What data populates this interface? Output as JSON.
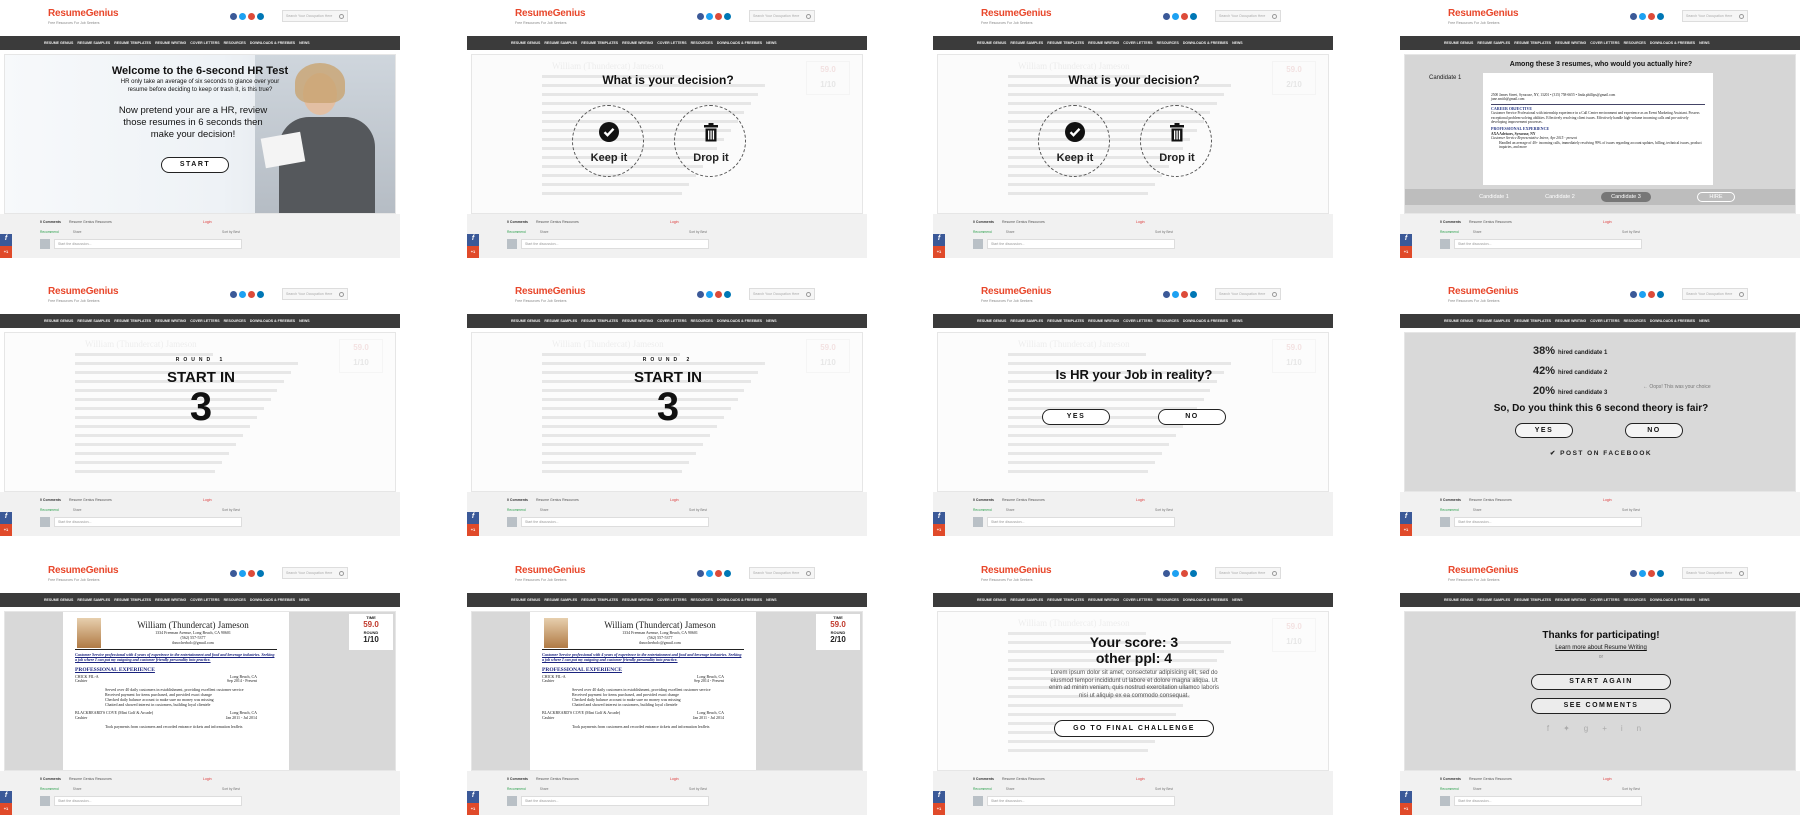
{
  "site": {
    "logo_resume": "Resume",
    "logo_genius": "Genius",
    "tagline": "Free Resources For Job Seekers",
    "search_placeholder": "Search Your Occupation Here",
    "nav": [
      "RESUME GENIUS",
      "RESUME SAMPLES",
      "RESUME TEMPLATES",
      "RESUME WRITING",
      "COVER LETTERS",
      "RESOURCES",
      "DOWNLOADS & FREEBIES",
      "NEWS"
    ],
    "social_colors": [
      "#3b5998",
      "#1da1f2",
      "#dd4b39",
      "#0077b5"
    ]
  },
  "comments": {
    "count": "0 Comments",
    "community": "Resume Genius Resources",
    "login": "Login",
    "recommend": "Recommend",
    "share": "Share",
    "sort": "Sort by Best",
    "placeholder": "Start the discussion..."
  },
  "welcome": {
    "title": "Welcome to the 6-second HR Test",
    "text": "HR only take an average of six seconds to glance over your resume before deciding to keep or trash it, is this true?",
    "prompt": "Now pretend your are a HR, review those resumes in 6 seconds then make your decision!",
    "start": "START"
  },
  "decision": {
    "title": "What is your decision?",
    "keep": "Keep it",
    "drop": "Drop it",
    "ghost_name": "William (Thundercat) Jameson",
    "ghost_time": "59.0",
    "ghost_rounds": [
      "1/10",
      "2/10"
    ]
  },
  "hire": {
    "title": "Among these 3 resumes, who would you actually hire?",
    "candidate_label": "Candidate 1",
    "resume_lines": [
      "2500 James Street, Syracuse, NY, 13201 • (315) 758-6655 • linda.phillips@gmail.com",
      "jane.smith@gmail.com"
    ],
    "objective_head": "CAREER OBJECTIVE",
    "objective": "Customer Service Professional with internship experience in a Call Center environment and experience as an Event Marketing Assistant. Possess exceptional problem-solving abilities. Effectively resolving client issues. Effectively handle high-volume incoming calls and pro-actively developing improvement processes.",
    "exp_head": "PROFESSIONAL EXPERIENCE",
    "exp_company": "AXA Advisors, Syracuse, NY",
    "exp_role": "Customer Service Representative Intern, Apr 2015 - present",
    "exp_bullet": "Handled an average of 40+ incoming calls, immediately resolving 99% of issues regarding account updates, billing, technical issues, product inquiries, and more",
    "tabs": [
      "Candidate 1",
      "Candidate 2",
      "Candidate 3"
    ],
    "hire_btn": "HIRE"
  },
  "countdown": [
    {
      "round": "ROUND 1",
      "start_in": "START IN",
      "number": "3"
    },
    {
      "round": "ROUND 2",
      "start_in": "START IN",
      "number": "3"
    }
  ],
  "hr_job": {
    "question": "Is HR your Job in reality?",
    "yes": "YES",
    "no": "NO"
  },
  "results": {
    "rows": [
      {
        "pct": "38%",
        "label": "hired candidate 1"
      },
      {
        "pct": "42%",
        "label": "hired candidate 2"
      },
      {
        "pct": "20%",
        "label": "hired candidate 3"
      }
    ],
    "oops": "← Oops! This was your choice",
    "question": "So, Do you think this 6 second theory is fair?",
    "yes": "YES",
    "no": "NO",
    "post": "POST ON FACEBOOK"
  },
  "resume": {
    "name": "William (Thundercat) Jameson",
    "address": "1334 Freeman Avenue, Long Beach, CA 90601",
    "phone": "(562) 557-5377",
    "email": "thnocherbolc@gmail.com",
    "summary": "Customer Service professional with 4 years of experience in the entertainment and food and beverage industries. Seeking a job where I can put my outgoing and customer friendly personality into practice.",
    "exp_head": "PROFESSIONAL EXPERIENCE",
    "job1_company": "CHICK FIL-A",
    "job1_loc": "Long Beach, CA",
    "job1_role": "Cashier",
    "job1_dates": "Sep 2014 - Present",
    "job1_bullets": [
      "Served over 40 daily customers in establishment, providing excellent customer service",
      "Received payment for items purchased, and provided exact change",
      "Checked daily balance account to make sure no money was missing",
      "Chatted and showed interest in customers, building loyal clientele"
    ],
    "job2_company": "BLACKBEARD'S COVE (Mini Golf & Arcade)",
    "job2_loc": "Long Beach, CA",
    "job2_role": "Cashier",
    "job2_dates": "Jan 2011 - Jul 2014",
    "job2_bullets": [
      "Took payments from customers and recorded entrance tickets and information leaflets"
    ],
    "time_label": "TIME",
    "time": "59.0",
    "round_label": "ROUND",
    "rounds": [
      "1/10",
      "2/10"
    ]
  },
  "score": {
    "line1": "Your score: 3",
    "line2": "other ppl: 4",
    "lorem": "Lorem ipsum dolor sit amet, consectetur adipisicing elit, sed do eiusmod tempor incididunt ut labore et dolore magna aliqua. Ut enim ad minim veniam, quis nostrud exercitation ullamco laboris nisi ut aliquip ex ea commodo consequat.",
    "final": "GO TO FINAL CHALLENGE"
  },
  "thanks": {
    "title": "Thanks for participating!",
    "link": "Learn more about Resume Writing",
    "or": "or",
    "again": "START AGAIN",
    "comments": "SEE COMMENTS"
  }
}
